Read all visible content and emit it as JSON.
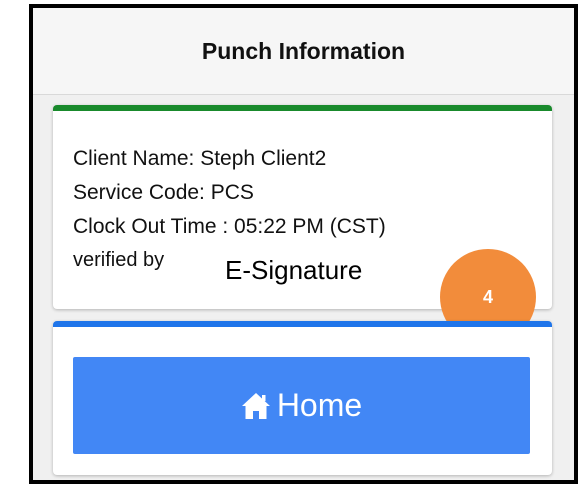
{
  "header": {
    "title": "Punch Information"
  },
  "punch_card": {
    "client_name": "Client Name: Steph Client2",
    "service_code": "Service Code: PCS",
    "clock_out_time": "Clock Out Time : 05:22 PM (CST)",
    "verified_by": "verified by",
    "verification_method": "E-Signature"
  },
  "annotation": {
    "step_number": "4"
  },
  "home_card": {
    "button_label": "Home",
    "button_icon": "home-icon"
  },
  "colors": {
    "info_card_accent": "#198a2c",
    "home_card_accent": "#1f75ea",
    "home_button": "#4287f5",
    "step_badge": "#f28c3b"
  }
}
